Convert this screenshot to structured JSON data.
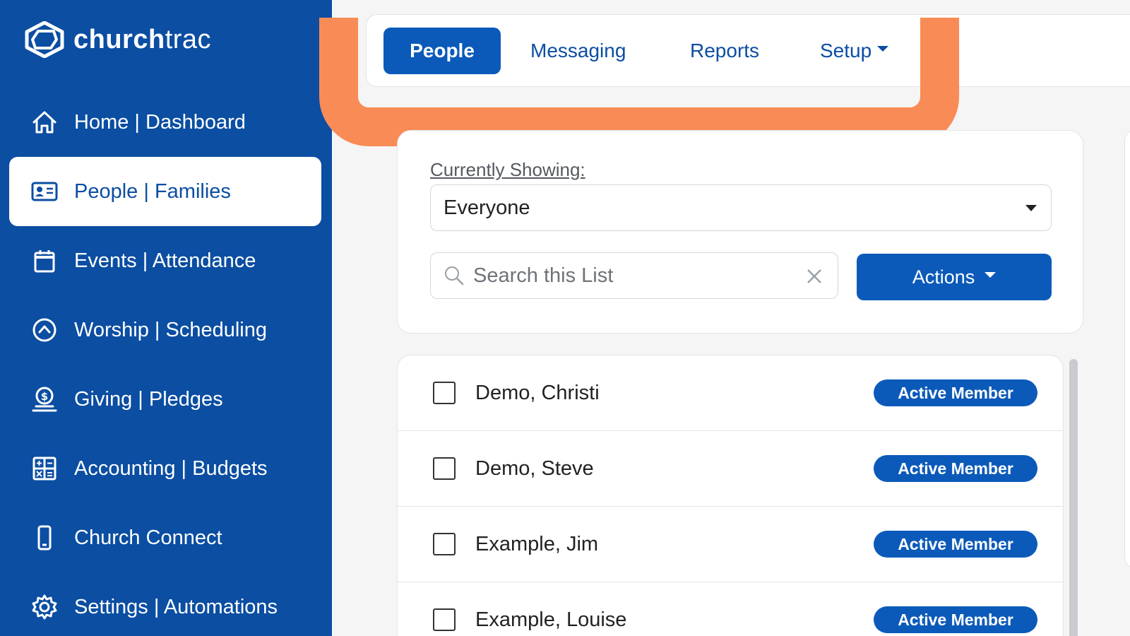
{
  "brand": {
    "name_bold": "church",
    "name_light": "trac"
  },
  "sidebar": {
    "items": [
      {
        "label": "Home | Dashboard",
        "icon": "home-icon"
      },
      {
        "label": "People | Families",
        "icon": "id-card-icon",
        "active": true
      },
      {
        "label": "Events | Attendance",
        "icon": "calendar-icon"
      },
      {
        "label": "Worship | Scheduling",
        "icon": "chevron-circle-icon"
      },
      {
        "label": "Giving | Pledges",
        "icon": "dollar-hand-icon"
      },
      {
        "label": "Accounting | Budgets",
        "icon": "calculator-icon"
      },
      {
        "label": "Church Connect",
        "icon": "mobile-phone-icon"
      },
      {
        "label": "Settings | Automations",
        "icon": "gear-icon"
      }
    ]
  },
  "tabs": [
    {
      "label": "People",
      "active": true
    },
    {
      "label": "Messaging"
    },
    {
      "label": "Reports"
    },
    {
      "label": "Setup",
      "dropdown": true
    }
  ],
  "filter": {
    "showing_label": "Currently Showing:",
    "selected": "Everyone",
    "search_placeholder": "Search this List",
    "actions_label": "Actions"
  },
  "people": [
    {
      "name": "Demo, Christi",
      "status": "Active Member"
    },
    {
      "name": "Demo, Steve",
      "status": "Active Member"
    },
    {
      "name": "Example, Jim",
      "status": "Active Member"
    },
    {
      "name": "Example, Louise",
      "status": "Active Member"
    }
  ],
  "colors": {
    "brand_blue": "#0b4ea2",
    "button_blue": "#0b5ab9",
    "highlight_orange": "#f98b56"
  }
}
